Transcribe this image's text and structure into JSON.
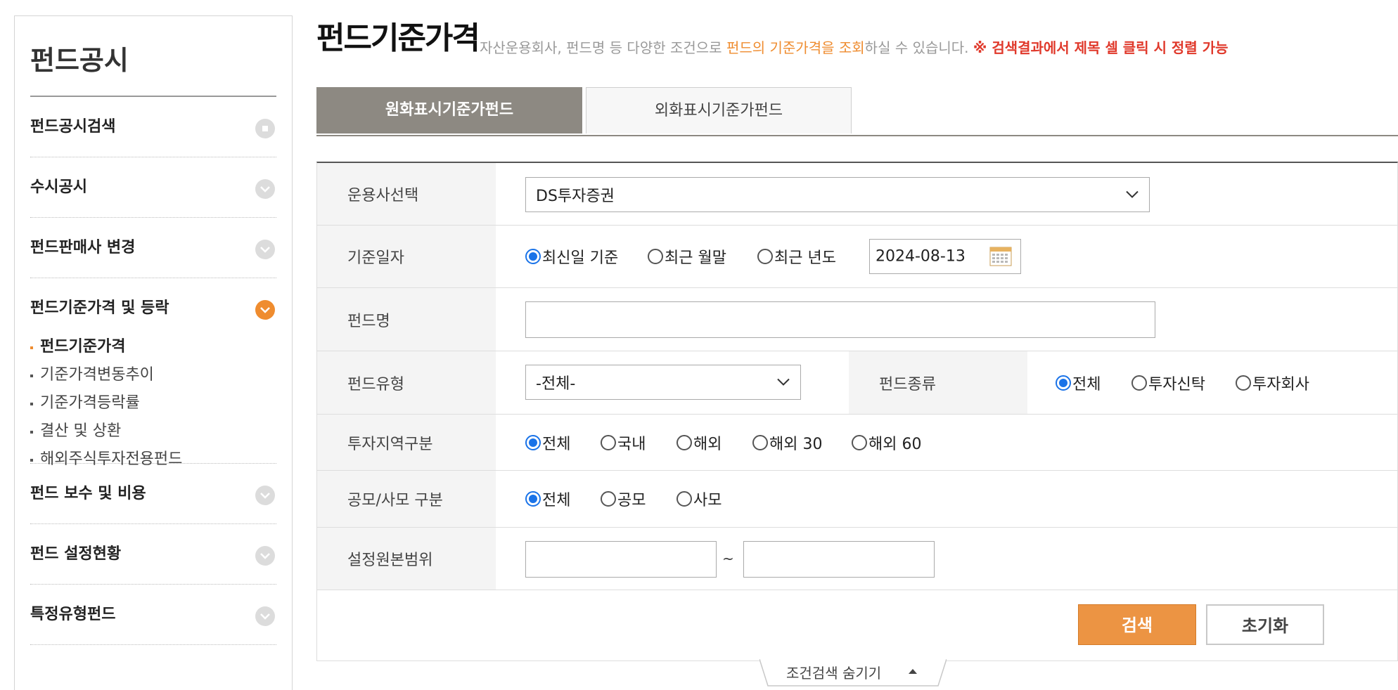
{
  "sidebar": {
    "title": "펀드공시",
    "items": [
      {
        "label": "펀드공시검색"
      },
      {
        "label": "수시공시"
      },
      {
        "label": "펀드판매사 변경"
      },
      {
        "label": "펀드기준가격 및 등락",
        "sub": [
          "펀드기준가격",
          "기준가격변동추이",
          "기준가격등락률",
          "결산 및 상환",
          "해외주식투자전용펀드"
        ]
      },
      {
        "label": "펀드 보수 및 비용"
      },
      {
        "label": "펀드 설정현황"
      },
      {
        "label": "특정유형펀드"
      }
    ]
  },
  "header": {
    "title": "펀드기준가격",
    "desc_pre": "자산운용회사, 펀드명 등 다양한 조건으로 ",
    "desc_hl": "펀드의 기준가격을 조회",
    "desc_post": "하실 수 있습니다. ",
    "desc_warn": "※ 검색결과에서 제목 셀 클릭 시 정렬 가능"
  },
  "tabs": [
    "원화표시기준가펀드",
    "외화표시기준가펀드"
  ],
  "form": {
    "company_label": "운용사선택",
    "company_value": "DS투자증권",
    "date_label": "기준일자",
    "date_options": [
      "최신일 기준",
      "최근 월말",
      "최근 년도"
    ],
    "date_value": "2024-08-13",
    "fund_name_label": "펀드명",
    "fund_name_value": "",
    "fund_type_label": "펀드유형",
    "fund_type_value": "-전체-",
    "fund_kind_label": "펀드종류",
    "fund_kind_options": [
      "전체",
      "투자신탁",
      "투자회사"
    ],
    "region_label": "투자지역구분",
    "region_options": [
      "전체",
      "국내",
      "해외",
      "해외 30",
      "해외 60"
    ],
    "public_label": "공모/사모 구분",
    "public_options": [
      "전체",
      "공모",
      "사모"
    ],
    "range_label": "설정원본범위",
    "range_separator": "~",
    "range_from": "",
    "range_to": ""
  },
  "buttons": {
    "search": "검색",
    "reset": "초기화"
  },
  "toggle": {
    "label": "조건검색 숨기기"
  },
  "colors": {
    "accent": "#ef8c2f",
    "tab_active": "#8d8982",
    "warn": "#e0392b",
    "radio": "#1a73e8"
  }
}
